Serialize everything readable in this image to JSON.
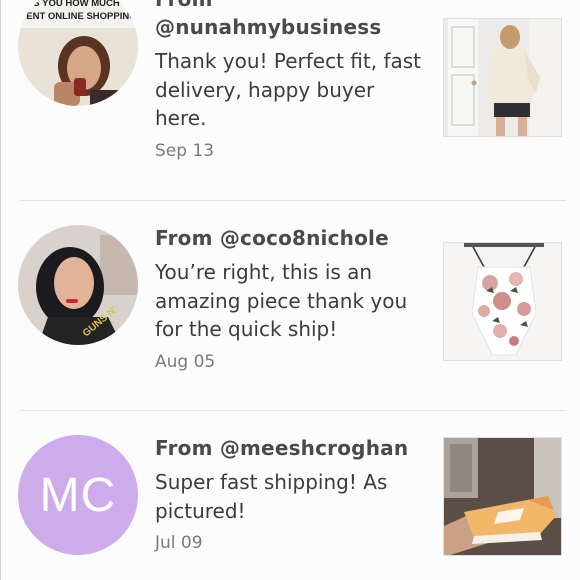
{
  "reviews": [
    {
      "from_prefix": "From",
      "username": "@nunahmybusiness",
      "message": "Thank you! Perfect fit, fast delivery, happy buyer here.",
      "date": "Sep 13",
      "avatar_icon": "photo-avatar",
      "thumb_icon": "cream-bomber-jacket-photo",
      "avatar_caption_line1": "ASKS YOU HOW MUCH YOU",
      "avatar_caption_line2": "SPENT ONLINE SHOPPING?"
    },
    {
      "from_prefix": "From",
      "username": "@coco8nichole",
      "message": "You’re right, this is an amazing piece thank you for the quick ship!",
      "date": "Aug 05",
      "avatar_icon": "photo-avatar",
      "thumb_icon": "floral-bodysuit-photo"
    },
    {
      "from_prefix": "From",
      "username": "@meeshcroghan",
      "message": "Super fast shipping! As pictured!",
      "date": "Jul 09",
      "avatar_initials": "MC",
      "avatar_color": "#ccaceb",
      "thumb_icon": "sneakers-photo"
    }
  ]
}
